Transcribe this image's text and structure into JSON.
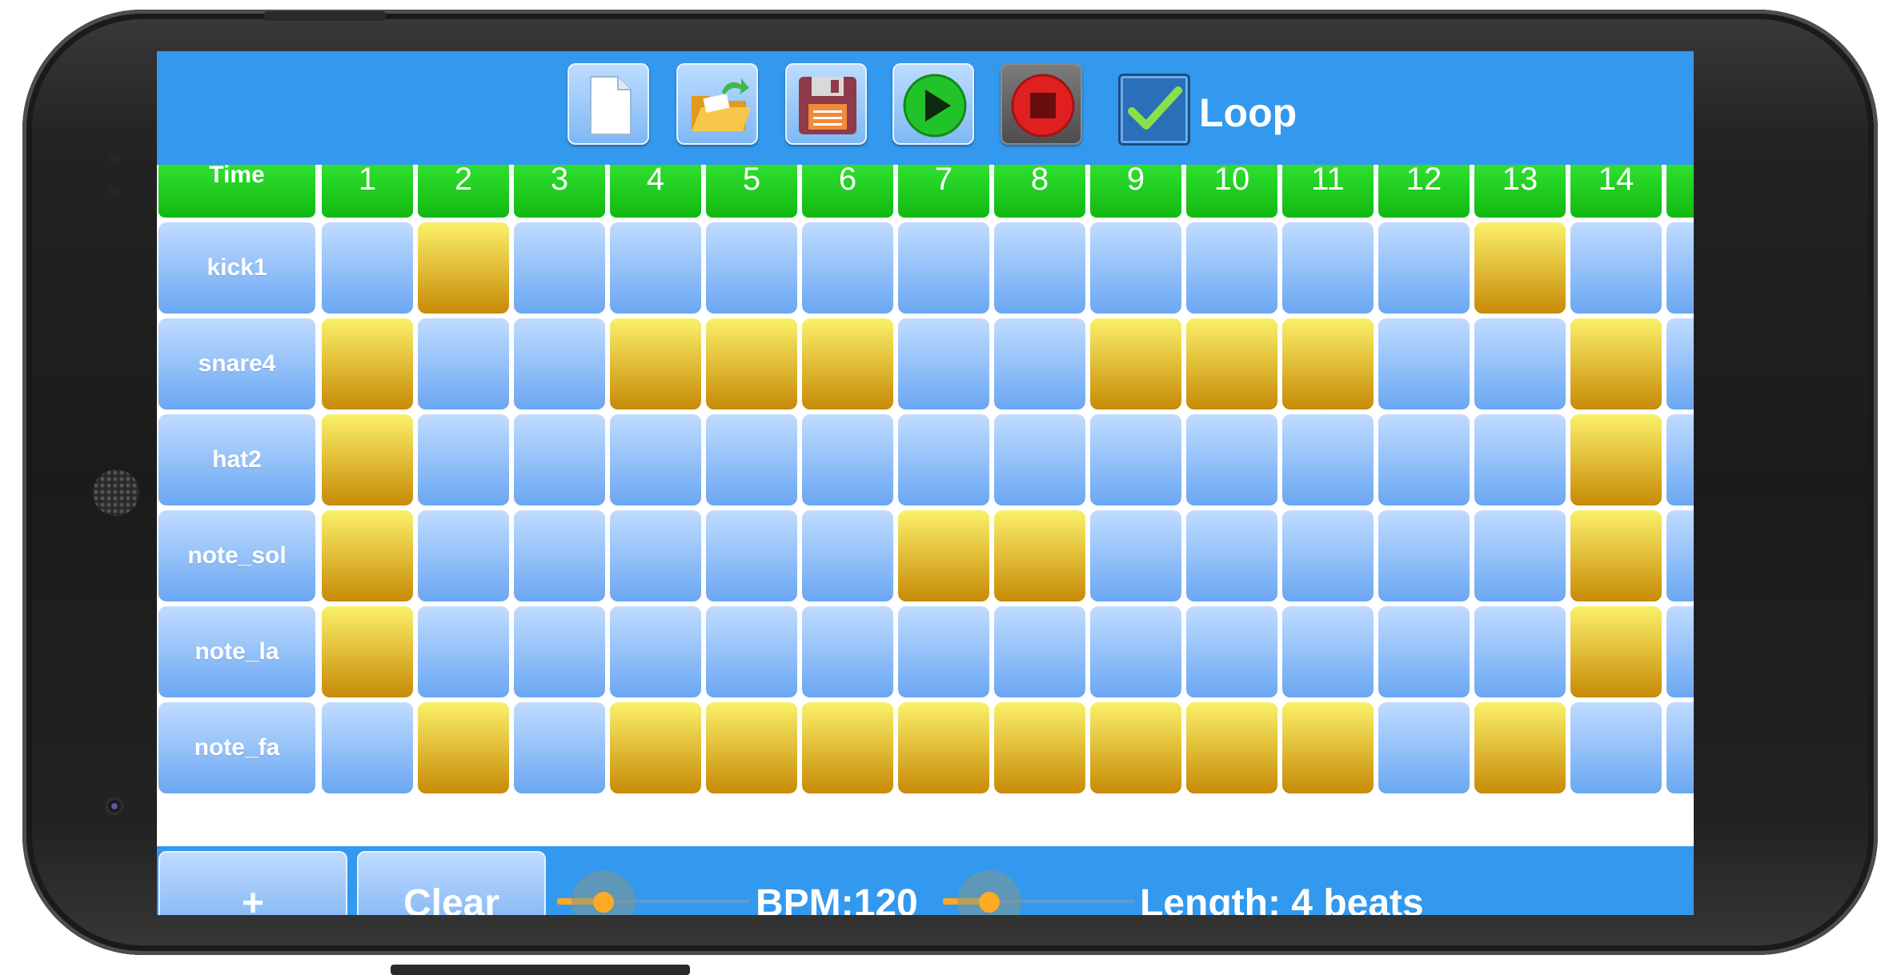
{
  "toolbar": {
    "buttons": [
      {
        "icon": "new-file-icon",
        "color": "#ffffff"
      },
      {
        "icon": "open-folder-icon",
        "color": "#f4b73a"
      },
      {
        "icon": "save-floppy-icon",
        "color": "#8e3a4a"
      },
      {
        "icon": "play-icon",
        "color": "#22c22a"
      },
      {
        "icon": "stop-icon",
        "color": "#e02020"
      }
    ],
    "loop": {
      "label": "Loop",
      "checked": true
    }
  },
  "grid": {
    "header_label": "Time",
    "columns": [
      "1",
      "2",
      "3",
      "4",
      "5",
      "6",
      "7",
      "8",
      "9",
      "10",
      "11",
      "12",
      "13",
      "14"
    ],
    "rows": [
      {
        "label": "kick1",
        "steps": [
          0,
          1,
          0,
          0,
          0,
          0,
          0,
          0,
          0,
          0,
          0,
          0,
          1,
          0
        ]
      },
      {
        "label": "snare4",
        "steps": [
          1,
          0,
          0,
          1,
          1,
          1,
          0,
          0,
          1,
          1,
          1,
          0,
          0,
          1
        ]
      },
      {
        "label": "hat2",
        "steps": [
          1,
          0,
          0,
          0,
          0,
          0,
          0,
          0,
          0,
          0,
          0,
          0,
          0,
          1
        ]
      },
      {
        "label": "note_sol",
        "steps": [
          1,
          0,
          0,
          0,
          0,
          0,
          1,
          1,
          0,
          0,
          0,
          0,
          0,
          1
        ]
      },
      {
        "label": "note_la",
        "steps": [
          1,
          0,
          0,
          0,
          0,
          0,
          0,
          0,
          0,
          0,
          0,
          0,
          0,
          1
        ]
      },
      {
        "label": "note_fa",
        "steps": [
          0,
          1,
          0,
          1,
          1,
          1,
          1,
          1,
          1,
          1,
          1,
          0,
          1,
          0
        ]
      }
    ],
    "colors": {
      "header": "#22cc22",
      "cell_off": "#8fc1f7",
      "cell_on": "#e8b420"
    }
  },
  "bottom": {
    "add_label": "+",
    "clear_label": "Clear",
    "bpm": {
      "text": "BPM:120",
      "slider_fraction": 0.24
    },
    "length": {
      "text": "Length: 4 beats",
      "slider_fraction": 0.24
    }
  },
  "colors": {
    "bar": "#3399ee",
    "accent": "#ffaa22"
  }
}
